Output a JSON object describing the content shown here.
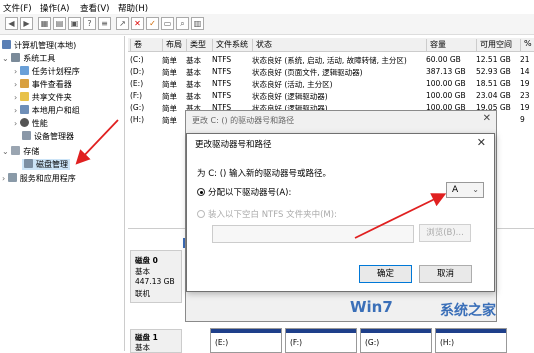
{
  "menu": [
    "文件(F)",
    "操作(A)",
    "查看(V)",
    "帮助(H)"
  ],
  "tree": {
    "root": "计算机管理(本地)",
    "system_tools": "系统工具",
    "items": [
      "任务计划程序",
      "事件查看器",
      "共享文件夹",
      "本地用户和组",
      "性能",
      "设备管理器"
    ],
    "storage": "存储",
    "disk_mgmt": "磁盘管理",
    "services": "服务和应用程序"
  },
  "columns": [
    "卷",
    "布局",
    "类型",
    "文件系统",
    "状态",
    "容量",
    "可用空间",
    "%"
  ],
  "rows": [
    {
      "vol": "(C:)",
      "layout": "简单",
      "type": "基本",
      "fs": "NTFS",
      "status": "状态良好 (系统, 启动, 活动, 故障转储, 主分区)",
      "cap": "60.00 GB",
      "free": "12.51 GB",
      "pct": "21"
    },
    {
      "vol": "(D:)",
      "layout": "简单",
      "type": "基本",
      "fs": "NTFS",
      "status": "状态良好 (页面文件, 逻辑驱动器)",
      "cap": "387.13 GB",
      "free": "52.93 GB",
      "pct": "14"
    },
    {
      "vol": "(E:)",
      "layout": "简单",
      "type": "基本",
      "fs": "NTFS",
      "status": "状态良好 (活动, 主分区)",
      "cap": "100.00 GB",
      "free": "18.51 GB",
      "pct": "19"
    },
    {
      "vol": "(F:)",
      "layout": "简单",
      "type": "基本",
      "fs": "NTFS",
      "status": "状态良好 (逻辑驱动器)",
      "cap": "100.00 GB",
      "free": "23.04 GB",
      "pct": "23"
    },
    {
      "vol": "(G:)",
      "layout": "简单",
      "type": "基本",
      "fs": "NTFS",
      "status": "状态良好 (逻辑驱动器)",
      "cap": "100.00 GB",
      "free": "19.05 GB",
      "pct": "19"
    },
    {
      "vol": "(H:)",
      "layout": "简单",
      "type": "基本",
      "fs": "",
      "status": "",
      "cap": "",
      "free": "",
      "pct": "9"
    }
  ],
  "back_dialog": {
    "title": "更改 C: () 的驱动器号和路径"
  },
  "dialog": {
    "title": "更改驱动器号和路径",
    "prompt": "为 C: () 输入新的驱动器号或路径。",
    "assign_label": "分配以下驱动器号(A):",
    "drive_letter": "A",
    "mount_label": "装入以下空白 NTFS 文件夹中(M):",
    "browse": "浏览(B)...",
    "ok": "确定",
    "cancel": "取消"
  },
  "disk0": {
    "name": "磁盘 0",
    "type": "基本",
    "size": "447.13 GB",
    "status": "联机"
  },
  "disk1": {
    "name": "磁盘 1",
    "type": "基本"
  },
  "bottom_vols": [
    "(E:)",
    "(F:)",
    "(G:)",
    "(H:)"
  ],
  "watermark": {
    "win7": "Win7",
    "site": "系统之家"
  },
  "colors": {
    "accent": "#0078d7",
    "arrow": "#e02020",
    "volume_bar": "#3b6bb7"
  }
}
